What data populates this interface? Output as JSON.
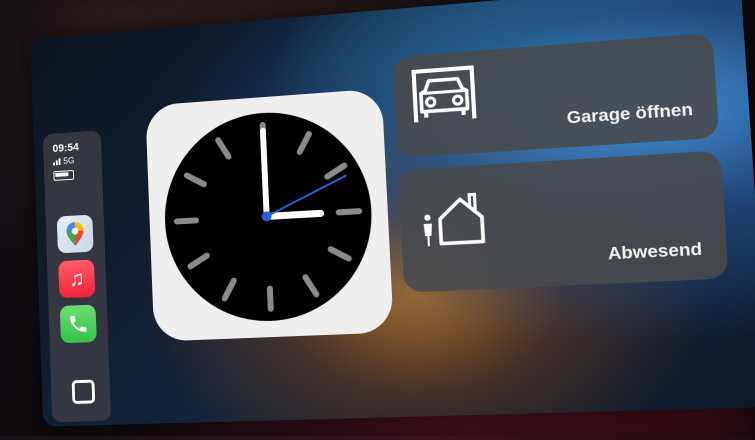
{
  "status": {
    "time": "09:54",
    "network": "5G"
  },
  "dock": {
    "apps": [
      {
        "name": "Google Maps",
        "icon": "maps-icon"
      },
      {
        "name": "Music",
        "icon": "music-note-icon",
        "glyph": "♫"
      },
      {
        "name": "Phone",
        "icon": "phone-icon"
      }
    ],
    "home_icon": "home-button-icon"
  },
  "clock": {
    "hour": 3,
    "minute": 0,
    "second": 11
  },
  "tiles": {
    "garage": {
      "label": "Garage öffnen",
      "icon": "garage-car-icon"
    },
    "away": {
      "label": "Abwesend",
      "icon": "person-house-icon"
    }
  },
  "colors": {
    "tile_bg": "#484a4e",
    "second_hand": "#2b5fd9",
    "music_red": "#f3243b",
    "phone_green": "#34c34a"
  }
}
